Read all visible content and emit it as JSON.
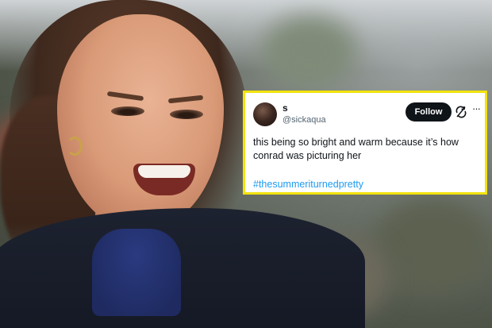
{
  "tweet": {
    "display_name": "s",
    "handle": "@sickaqua",
    "follow_label": "Follow",
    "sync_icon": "sync-icon",
    "more_icon": "more-icon",
    "more_glyph": "···",
    "text": "this being so bright and warm because it’s how conrad was picturing her",
    "hashtag": "#thesummeriturnedpretty",
    "border_color": "#f2e20e",
    "hashtag_color": "#1d9bf0"
  }
}
